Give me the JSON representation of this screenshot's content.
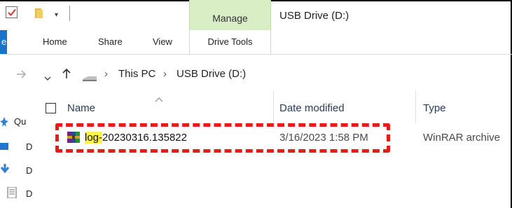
{
  "title_bar": {
    "window_title": "USB Drive (D:)",
    "contextual_tab_group": "Manage",
    "quick_access_dropdown": "▾"
  },
  "ribbon": {
    "file_tab_fragment": "e",
    "tabs": [
      "Home",
      "Share",
      "View"
    ],
    "contextual_tab": "Drive Tools"
  },
  "address_bar": {
    "path": [
      "This PC",
      "USB Drive (D:)"
    ],
    "separator": "›",
    "drive_icon": "usb-drive-icon"
  },
  "columns": {
    "name": "Name",
    "date_modified": "Date modified",
    "type": "Type",
    "sort_indicator": "^"
  },
  "nav_pane": {
    "items": [
      {
        "icon": "quick-access-star-icon",
        "label": "Qu"
      },
      {
        "icon": "desktop-icon",
        "label": "D"
      },
      {
        "icon": "downloads-icon",
        "label": "D"
      },
      {
        "icon": "documents-icon",
        "label": "D"
      }
    ]
  },
  "files": [
    {
      "name_highlighted": "log-",
      "name_rest": "20230316.135822",
      "date_modified": "3/16/2023 1:58 PM",
      "type": "WinRAR archive",
      "icon": "winrar-archive-icon"
    }
  ],
  "annotation": {
    "color": "#e81b1b",
    "style": "dashed highlight box"
  },
  "colors": {
    "accent_blue": "#1a73c8",
    "manage_green": "#d9eec5",
    "highlight_yellow": "#fff34d"
  }
}
